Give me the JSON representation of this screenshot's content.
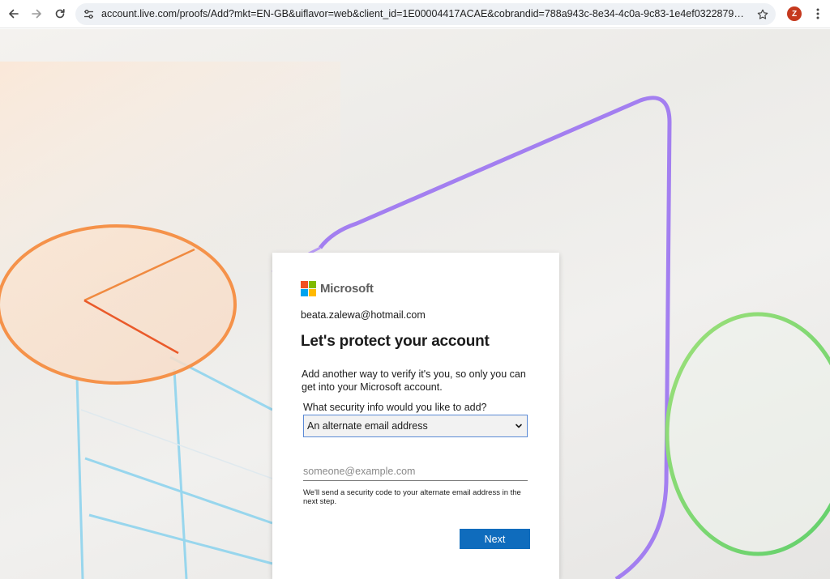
{
  "browser": {
    "url": "account.live.com/proofs/Add?mkt=EN-GB&uiflavor=web&client_id=1E00004417ACAE&cobrandid=788a943c-8e34-4c0a-9c83-1e4ef0322879&id=0&lqsp=ntp...",
    "profile_initial": "Z",
    "profile_color": "#c5391e",
    "icons": {
      "back": "back-arrow-icon",
      "forward": "forward-arrow-icon",
      "reload": "reload-icon",
      "site_info": "tune-icon",
      "bookmark": "star-icon",
      "menu": "kebab-menu-icon"
    }
  },
  "brand": {
    "name": "Microsoft",
    "logo_colors": [
      "#f25022",
      "#7fba00",
      "#00a4ef",
      "#ffb900"
    ]
  },
  "dialog": {
    "account_email": "beata.zalewa@hotmail.com",
    "title": "Let's protect your account",
    "description": "Add another way to verify it's you, so only you can get into your Microsoft account.",
    "select_label": "What security info would you like to add?",
    "select_value": "An alternate email address",
    "email_placeholder": "someone@example.com",
    "email_value": "",
    "helper_text": "We'll send a security code to your alternate email address in the next step.",
    "next_label": "Next",
    "accent_color": "#0f6cbd"
  }
}
